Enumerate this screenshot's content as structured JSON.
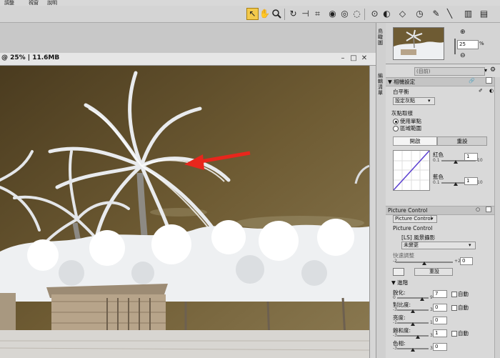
{
  "menu": {
    "items": [
      "調整",
      "視窗",
      "說明"
    ]
  },
  "toolbar": {
    "icons": [
      "direct-select-arrow",
      "hand",
      "zoom",
      "rotate",
      "straighten",
      "crop",
      "red-eye",
      "auto-retouch",
      "color-picker",
      "control-point",
      "view",
      "mask",
      "color-control",
      "levels",
      "tone"
    ]
  },
  "document": {
    "title": "@ 25% | 11.6MB"
  },
  "side_strip": {
    "label_top": "鳥瞰圖",
    "label_bottom": "編輯清單"
  },
  "navigator": {
    "zoom_value": "25",
    "zoom_unit": "%"
  },
  "adjust": {
    "preset": "(目前)",
    "camera_settings": "相機設定",
    "white_balance": {
      "label": "白平衡",
      "value": "設定灰點"
    },
    "gray_point": {
      "label": "灰點取樣",
      "opt1": "使用單點",
      "opt2": "區域範圍",
      "tab_active": "開啟",
      "tab_other": "重設",
      "red": {
        "label": "紅色",
        "min": "0.1",
        "max": "10",
        "value": "1"
      },
      "blue": {
        "label": "藍色",
        "min": "0.1",
        "max": "10",
        "value": "1"
      }
    },
    "picture_control": {
      "header": "Picture Control",
      "select": "Picture Control",
      "label": "Picture Control",
      "name": "[LS] 風景攝影",
      "status": "未變更",
      "quick_adjust": "快速調整",
      "quick_value": "0",
      "quick_min": "-2",
      "quick_max": "+2",
      "reset": "重設"
    },
    "advanced": {
      "label": "進階",
      "auto": "自動",
      "rows": [
        {
          "label": "銳化:",
          "min": "0",
          "max": "9",
          "value": "7"
        },
        {
          "label": "對比度:",
          "min": "-3",
          "max": "3",
          "value": "0"
        },
        {
          "label": "亮度:",
          "min": "-1",
          "max": "1",
          "value": "0"
        },
        {
          "label": "飽和度:",
          "min": "-3",
          "max": "3",
          "value": "1"
        },
        {
          "label": "色相:",
          "min": "-3",
          "max": "3",
          "value": "0"
        }
      ]
    }
  },
  "colors": {
    "sky": "#6e5b33",
    "foliage": "#eef0f2",
    "arrow": "#e8261c",
    "accent": "#f3c94b"
  }
}
